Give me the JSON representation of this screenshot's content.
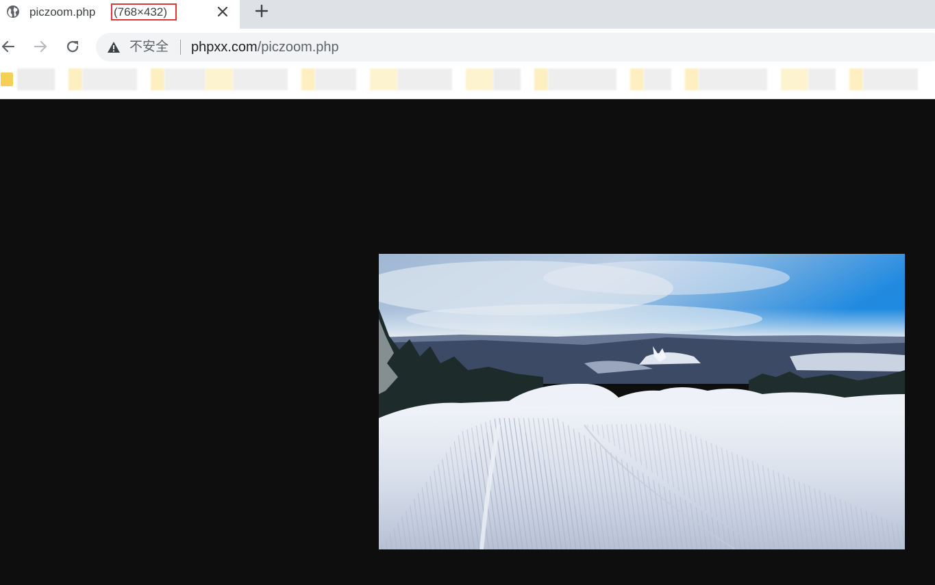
{
  "tab": {
    "title": "piczoom.php",
    "dimensions": "(768×432)",
    "dimensions_highlight_color": "#e0353b"
  },
  "toolbar": {
    "security_label": "不安全",
    "url_host": "phpxx.com",
    "url_path": "/piczoom.php",
    "icons": [
      "back-arrow-icon",
      "forward-arrow-icon",
      "reload-icon",
      "warning-triangle-icon"
    ]
  },
  "bookmarks": {
    "note_visible": "blurred bookmark items",
    "folder_color": "#f6cf55"
  },
  "content": {
    "background_color": "#0e0e0e",
    "image": {
      "subject": "groomed ski slope with snowy hills, forest and blue sky",
      "natural_size": "768×432"
    }
  }
}
